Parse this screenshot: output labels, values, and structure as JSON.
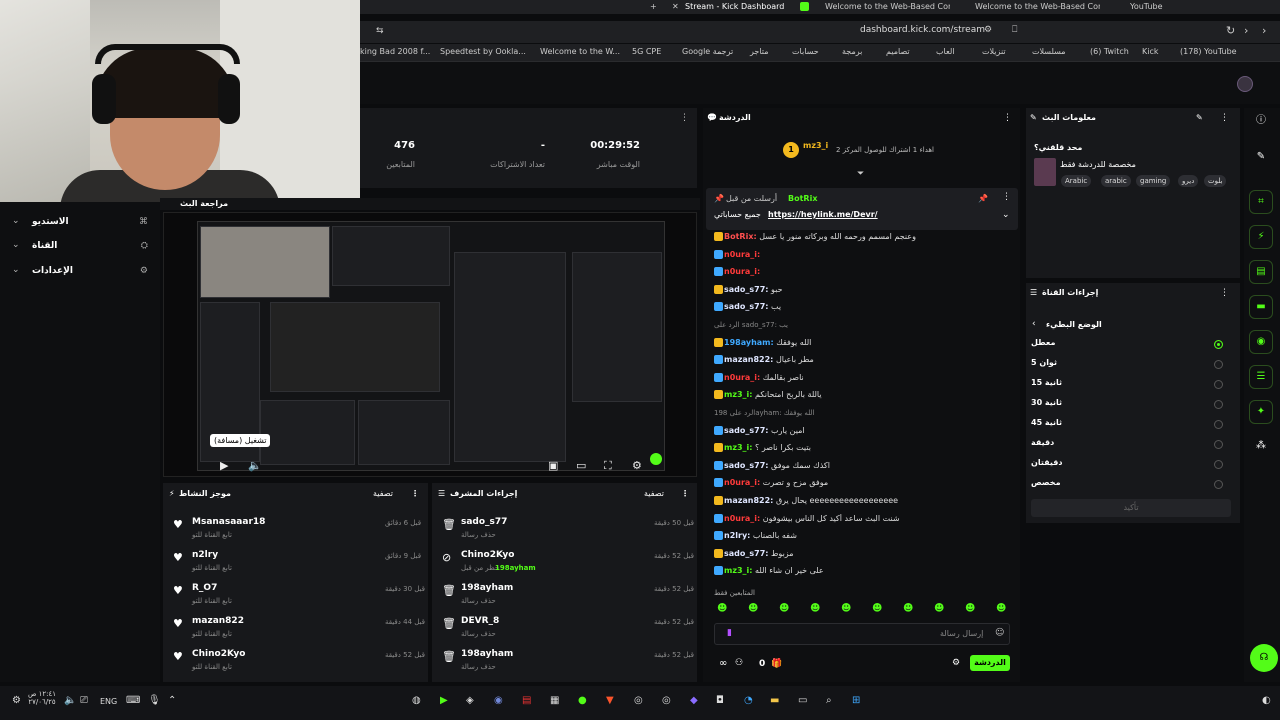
{
  "tabs": {
    "active": "Stream - Kick Dashboard",
    "t2": "Welcome to the Web-Based Configura...",
    "t3": "Welcome to the Web-Based Configura...",
    "t4": "YouTube"
  },
  "address": {
    "url": "dashboard.kick.com/stream"
  },
  "bookmarks": [
    "king Bad 2008 f...",
    "Speedtest by Ookla...",
    "Welcome to the W...",
    "5G CPE",
    "Google ترجمة",
    "متاجر",
    "حسابات",
    "برمجة",
    "تصاميم",
    "العاب",
    "تنزيلات",
    "مسلسلات",
    "(6) Twitch",
    "Kick",
    "(178) YouTube"
  ],
  "stats": {
    "viewers_value": "476",
    "viewers_label": "المتابعين",
    "subs_value": "-",
    "subs_label": "تعداد الاشتراكات",
    "live_value": "00:29:52",
    "live_label": "الوقت مباشر"
  },
  "leftnav": {
    "studio": "الاستديو",
    "channel": "القناة",
    "settings": "الإعدادات"
  },
  "preview": {
    "title": "مراجعة البث",
    "tooltip": "تشغيل (مسافة)"
  },
  "activity": {
    "title": "موجز النشاط",
    "filter": "تصفية",
    "items": [
      {
        "name": "Msanasaaar18",
        "sub": "تابع القناة للتو",
        "time": "قبل 6 دقائق"
      },
      {
        "name": "n2lry",
        "sub": "تابع القناة للتو",
        "time": "قبل 9 دقائق"
      },
      {
        "name": "R_O7",
        "sub": "تابع القناة للتو",
        "time": "قبل 30 دقيقة"
      },
      {
        "name": "mazan822",
        "sub": "تابع القناة للتو",
        "time": "قبل 44 دقيقة"
      },
      {
        "name": "Chino2Kyo",
        "sub": "تابع القناة للتو",
        "time": "قبل 52 دقيقة"
      }
    ]
  },
  "modactions": {
    "title": "إجراءات المشرف",
    "filter": "تصفية",
    "items": [
      {
        "name": "sado_s77",
        "sub": "حذف رسالة",
        "time": "قبل 50 دقيقة"
      },
      {
        "name": "Chino2Kyo",
        "sub": "حظر من قبل",
        "extra": "198ayham",
        "time": "قبل 52 دقيقة"
      },
      {
        "name": "198ayham",
        "sub": "حذف رسالة",
        "time": "قبل 52 دقيقة"
      },
      {
        "name": "DEVR_8",
        "sub": "حذف رسالة",
        "time": "قبل 52 دقيقة"
      },
      {
        "name": "198ayham",
        "sub": "حذف رسالة",
        "time": "قبل 52 دقيقة"
      }
    ]
  },
  "chat": {
    "title": "الدردشة",
    "top_user": "mz3_i",
    "top_text": "اهداء 1 اشتراك للوصول المركز 2",
    "pinned_by": "BotRix",
    "pinned_label": "أرسلت من قبل",
    "pinned_text": "جميع حساباتي",
    "pinned_link": "https://heylink.me/Devr/",
    "messages": [
      {
        "user": "BotRix:",
        "text": "وعنجم امسمم ورحمه الله وبركاته منور يا عسل",
        "color": "#ff4f4f"
      },
      {
        "user": "n0ura_i:",
        "text": "",
        "color": "#ff3b3b"
      },
      {
        "user": "n0ura_i:",
        "text": "",
        "color": "#ff3b3b"
      },
      {
        "user": "sado_s77:",
        "text": "حبو",
        "color": "#dfe6ff"
      },
      {
        "user": "sado_s77:",
        "text": "يب",
        "color": "#dfe6ff"
      },
      {
        "user": "",
        "text": "الرد على sado_s77: يب",
        "color": "#888"
      },
      {
        "user": "198ayham:",
        "text": "الله يوفقك",
        "color": "#3fa9ff"
      },
      {
        "user": "mazan822:",
        "text": "مطر باعيال",
        "color": "#dfe6ff"
      },
      {
        "user": "n0ura_i:",
        "text": "ناصر بقالمك",
        "color": "#ff3b3b"
      },
      {
        "user": "mz3_i:",
        "text": "ياللة بالربح امتحانكم",
        "color": "#53fc18"
      },
      {
        "user": "",
        "text": "الرد على 198ayham: الله يوفقك",
        "color": "#888"
      },
      {
        "user": "sado_s77:",
        "text": "امين يارب",
        "color": "#dfe6ff"
      },
      {
        "user": "mz3_i:",
        "text": "بتيت بكرا ناصر ؟",
        "color": "#53fc18"
      },
      {
        "user": "sado_s77:",
        "text": "اكذك سمك موفق",
        "color": "#dfe6ff"
      },
      {
        "user": "n0ura_i:",
        "text": "موفق مزح و تصرت",
        "color": "#ff3b3b"
      },
      {
        "user": "mazan822:",
        "text": "يحال يرق eeeeeeeeeeeeeeeeee",
        "color": "#dfe6ff"
      },
      {
        "user": "n0ura_i:",
        "text": "شنت البث ساعد أكيد كل الناس بيشوفون",
        "color": "#ff3b3b"
      },
      {
        "user": "n2lry:",
        "text": "شفه بالصناب",
        "color": "#dfe6ff"
      },
      {
        "user": "sado_s77:",
        "text": "مزبوط",
        "color": "#dfe6ff"
      },
      {
        "user": "mz3_i:",
        "text": "على خير ان شاء الله",
        "color": "#53fc18"
      }
    ],
    "followers_only": "المتابعين فقط",
    "input_placeholder": "إرسال رسالة",
    "send": "الدردشة",
    "count": "0"
  },
  "info": {
    "title": "معلومات البث",
    "stream_title": "محد قلقني؟",
    "category": "مخصصة للدردشة فقط",
    "tags": [
      "Arabic",
      "arabic",
      "gaming",
      "ديرو",
      "بلوت"
    ]
  },
  "ops": {
    "title": "إجراءات القناة",
    "slow_mode": "الوضع البطيء",
    "options": [
      "معطل",
      "ثوان 5",
      "ثانية 15",
      "ثانية 30",
      "ثانية 45",
      "دقيقة",
      "دقيقتان",
      "مخصص"
    ],
    "confirm": "تأكيد"
  },
  "taskbar": {
    "lang": "ENG",
    "time": "١٢:٤١ ص",
    "date": "٢٧/٠٦/٢٥"
  },
  "colors": {
    "accent": "#53fc18",
    "panel": "#17181b",
    "bg": "#0e0f11"
  }
}
